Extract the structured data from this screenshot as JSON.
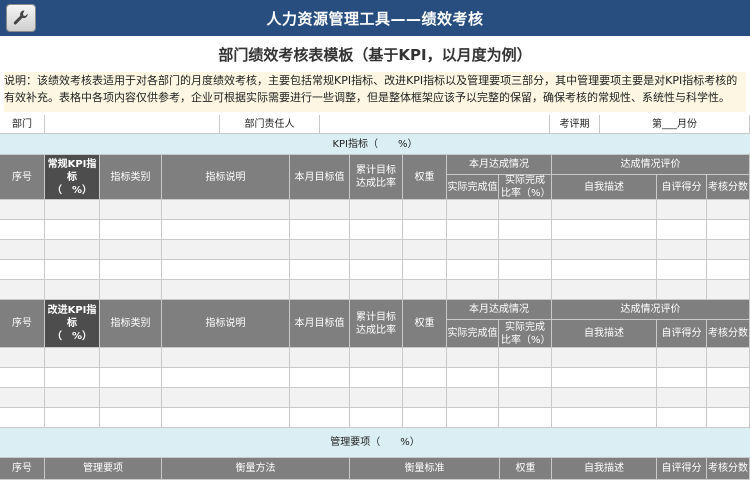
{
  "app": {
    "title": "人力资源管理工具——绩效考核"
  },
  "doc": {
    "title": "部门绩效考核表模板（基于KPI，以月度为例）",
    "description": "说明：该绩效考核表适用于对各部门的月度绩效考核，主要包括常规KPI指标、改进KPI指标以及管理要项三部分，其中管理要项主要是对KPI指标考核的有效补充。表格中各项内容仅供参考，企业可根据实际需要进行一些调整，但是整体框架应该予以完整的保留，确保考核的常规性、系统性与科学性。"
  },
  "info_row": {
    "dept_label": "部门",
    "dept_value": "",
    "leader_label": "部门责任人",
    "leader_value": "",
    "period_label": "考评期",
    "period_value": "第___月份"
  },
  "section1": {
    "band": "KPI指标（　　%）",
    "headers": {
      "seq": "序号",
      "kpi": "常规KPI指标\n（　%）",
      "category": "指标类别",
      "desc": "指标说明",
      "monthly_target": "本月目标值",
      "cum_rate": "累计目标达成比率",
      "weight": "权重",
      "month_status": "本月达成情况",
      "actual_value": "实际完成值",
      "actual_rate": "实际完成比率（%）",
      "eval": "达成情况评价",
      "self_desc": "自我描述",
      "self_score": "自评得分",
      "exam_score": "考核分数"
    }
  },
  "section2": {
    "headers": {
      "seq": "序号",
      "kpi": "改进KPI指标\n（　%）",
      "category": "指标类别",
      "desc": "指标说明",
      "monthly_target": "本月目标值",
      "cum_rate": "累计目标达成比率",
      "weight": "权重",
      "month_status": "本月达成情况",
      "actual_value": "实际完成值",
      "actual_rate": "实际完成比率（%）",
      "eval": "达成情况评价",
      "self_desc": "自我描述",
      "self_score": "自评得分",
      "exam_score": "考核分数"
    }
  },
  "section3": {
    "band": "管理要项（　　%）",
    "headers": {
      "seq": "序号",
      "item": "管理要项",
      "method": "衡量方法",
      "standard": "衡量标准",
      "weight": "权重",
      "self_desc": "自我描述",
      "self_score": "自评得分",
      "exam_score": "考核分数"
    }
  },
  "colors": {
    "title_bar": "#284e80",
    "band": "#daeef3",
    "header": "#7f7f7f",
    "header_dark": "#4d4d4d"
  }
}
